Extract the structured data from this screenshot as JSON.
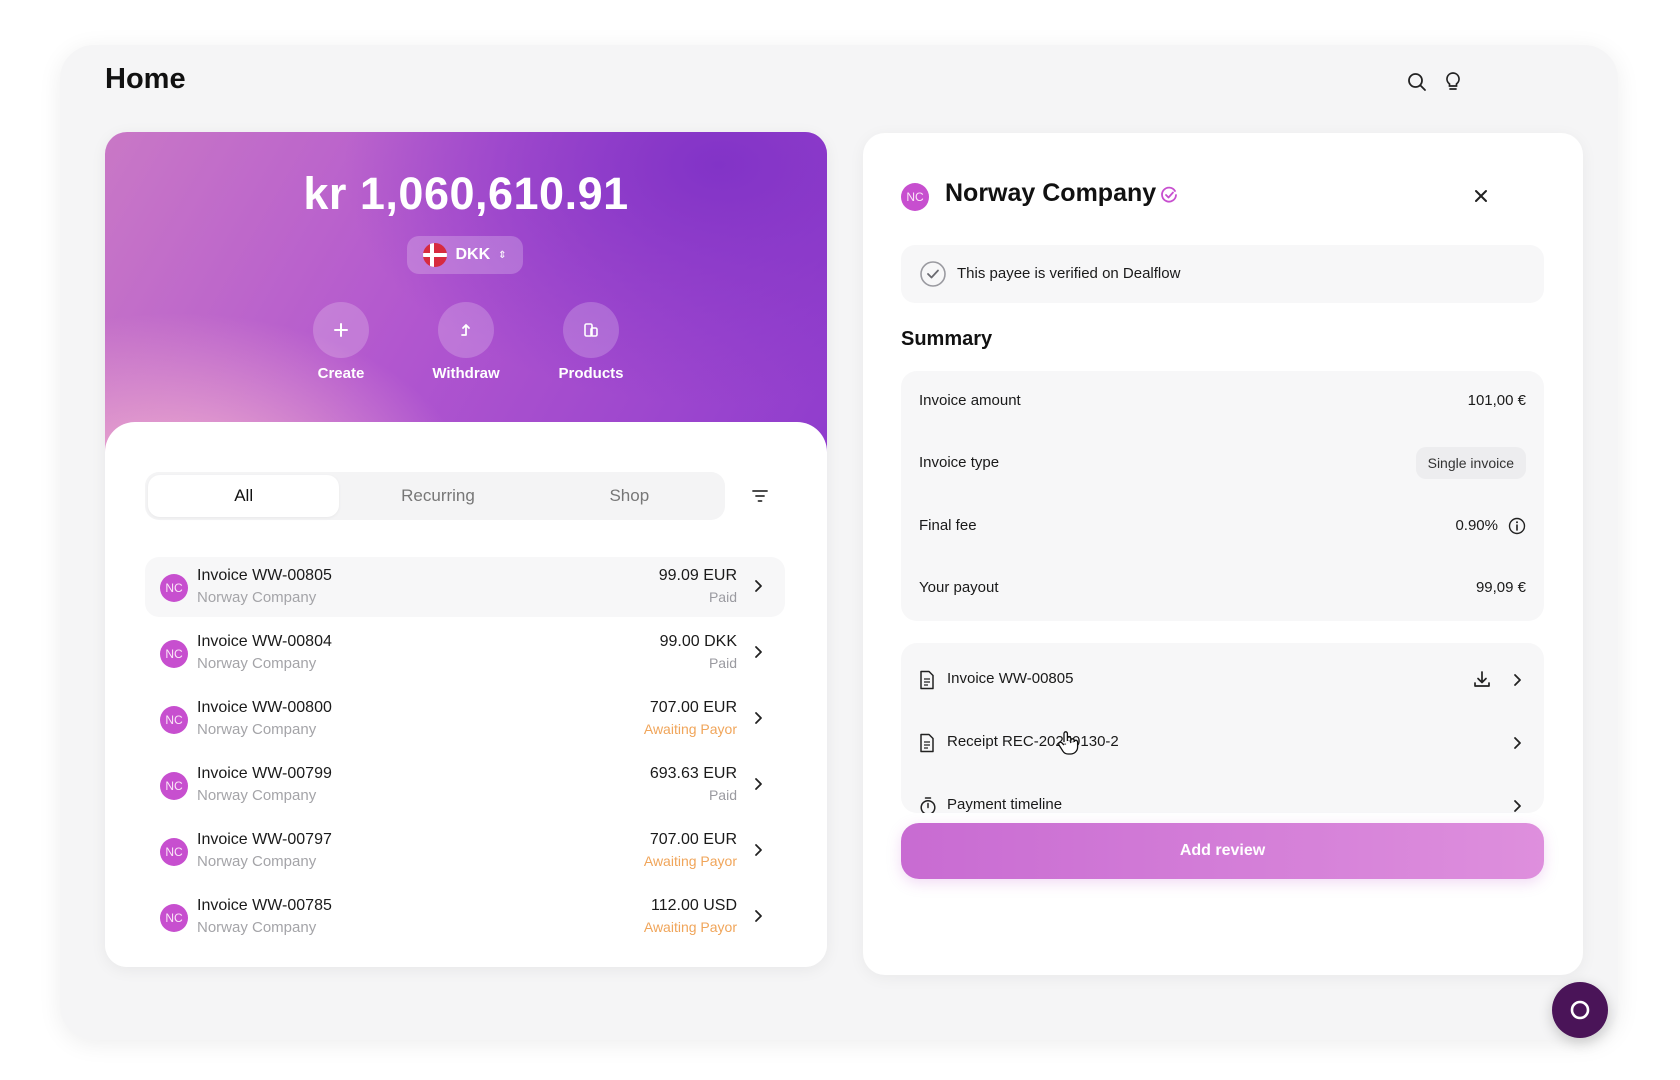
{
  "page": {
    "title": "Home"
  },
  "header_icons": {
    "search": "search-icon",
    "tips": "lightbulb-icon"
  },
  "wallet": {
    "balance": "kr 1,060,610.91",
    "currency": "DKK",
    "actions": [
      {
        "label": "Create",
        "icon": "plus-icon"
      },
      {
        "label": "Withdraw",
        "icon": "withdraw-arrow-icon"
      },
      {
        "label": "Products",
        "icon": "products-icon"
      }
    ]
  },
  "tabs": [
    {
      "label": "All",
      "active": true
    },
    {
      "label": "Recurring",
      "active": false
    },
    {
      "label": "Shop",
      "active": false
    }
  ],
  "invoices": [
    {
      "initials": "NC",
      "title": "Invoice WW-00805",
      "company": "Norway Company",
      "amount": "99.09 EUR",
      "status": "Paid",
      "status_type": "paid"
    },
    {
      "initials": "NC",
      "title": "Invoice WW-00804",
      "company": "Norway Company",
      "amount": "99.00 DKK",
      "status": "Paid",
      "status_type": "paid"
    },
    {
      "initials": "NC",
      "title": "Invoice WW-00800",
      "company": "Norway Company",
      "amount": "707.00 EUR",
      "status": "Awaiting Payor",
      "status_type": "awaiting"
    },
    {
      "initials": "NC",
      "title": "Invoice WW-00799",
      "company": "Norway Company",
      "amount": "693.63 EUR",
      "status": "Paid",
      "status_type": "paid"
    },
    {
      "initials": "NC",
      "title": "Invoice WW-00797",
      "company": "Norway Company",
      "amount": "707.00 EUR",
      "status": "Awaiting Payor",
      "status_type": "awaiting"
    },
    {
      "initials": "NC",
      "title": "Invoice WW-00785",
      "company": "Norway Company",
      "amount": "112.00 USD",
      "status": "Awaiting Payor",
      "status_type": "awaiting"
    }
  ],
  "detail": {
    "initials": "NC",
    "company": "Norway Company",
    "verified_text": "This payee is verified on Dealflow",
    "summary_title": "Summary",
    "summary": {
      "invoice_amount_label": "Invoice amount",
      "invoice_amount_value": "101,00 €",
      "invoice_type_label": "Invoice type",
      "invoice_type_value": "Single invoice",
      "final_fee_label": "Final fee",
      "final_fee_value": "0.90%",
      "payout_label": "Your payout",
      "payout_value": "99,09 €"
    },
    "documents": [
      {
        "label": "Invoice WW-00805",
        "icon": "document-icon",
        "downloadable": true
      },
      {
        "label": "Receipt REC-20250130-2",
        "icon": "document-icon",
        "downloadable": false
      },
      {
        "label": "Payment timeline",
        "icon": "timer-icon",
        "downloadable": false
      }
    ],
    "add_review_label": "Add review"
  },
  "colors": {
    "accent": "#c74fcf",
    "awaiting": "#f0a55a",
    "chat": "#4a1458"
  }
}
